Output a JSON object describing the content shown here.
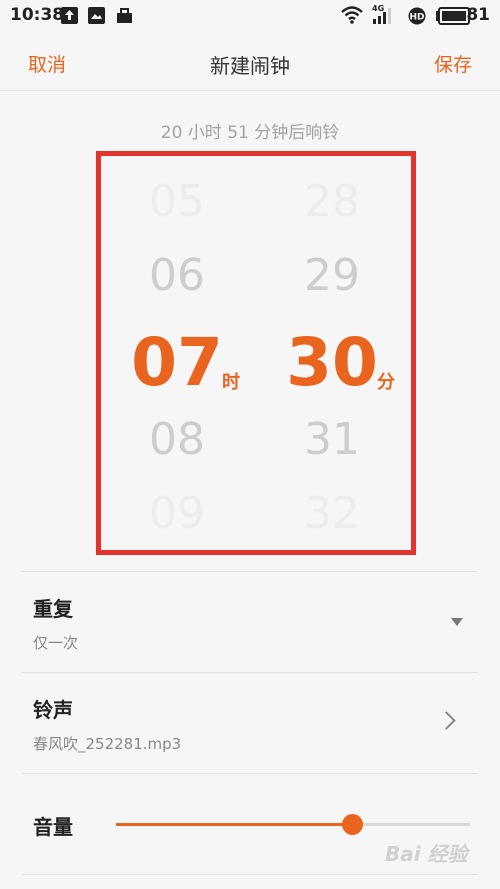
{
  "status_bar": {
    "time": "10:38",
    "network": "4G",
    "battery": "81",
    "icons": [
      "upload-icon",
      "image-icon",
      "bag-icon",
      "wifi-icon",
      "signal-icon",
      "hd-icon",
      "battery-icon"
    ]
  },
  "header": {
    "cancel_label": "取消",
    "title": "新建闹钟",
    "save_label": "保存"
  },
  "countdown_text": "20 小时 51 分钟后响铃",
  "picker": {
    "hours": [
      "05",
      "06",
      "07",
      "08",
      "09"
    ],
    "hour_unit": "时",
    "minutes": [
      "28",
      "29",
      "30",
      "31",
      "32"
    ],
    "minute_unit": "分",
    "selected_index": 2
  },
  "settings": {
    "repeat_label": "重复",
    "repeat_value": "仅一次",
    "ringtone_label": "铃声",
    "ringtone_value": "春风吹_252281.mp3",
    "volume_label": "音量",
    "volume_level": 0.67
  },
  "colors": {
    "accent": "#e8641f",
    "highlight_border": "#e0342d"
  },
  "watermark": "Bai 经验"
}
